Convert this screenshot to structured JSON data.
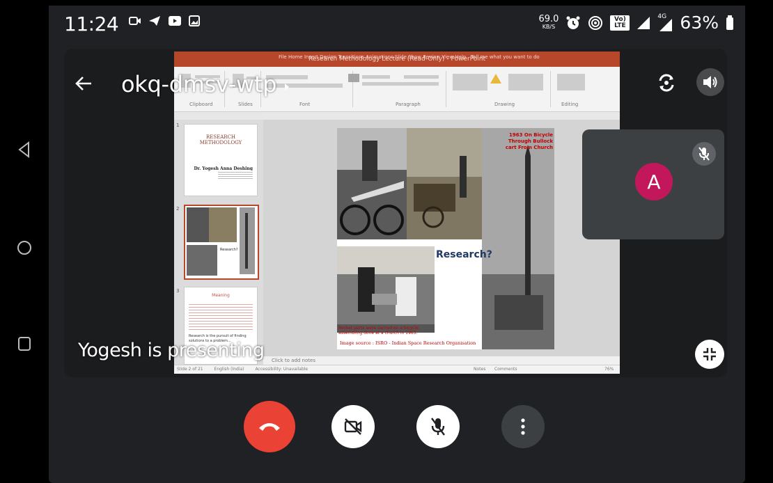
{
  "status_bar": {
    "time": "11:24",
    "net_speed_value": "69.0",
    "net_speed_unit": "KB/S",
    "volte": "Vo) LTE",
    "network": "4G",
    "battery": "63%"
  },
  "meeting": {
    "code": "okq-dmsv-wtp",
    "presenting_text": "Yogesh is presenting"
  },
  "participant": {
    "initial": "A",
    "avatar_color": "#c2185b"
  },
  "colors": {
    "end_call": "#ea4335",
    "tile_bg": "#3c4043",
    "ppt_accent": "#b7472a"
  },
  "presentation": {
    "window_title": "Research Methodology Lecture (Read-Only) - PowerPoint",
    "ribbon_tabs": "File  Home  Insert  Design  Transitions  Animations  Slide Show  Review  View  Help",
    "tell_me": "Tell me what you want to do",
    "ribbon_groups": [
      "Clipboard",
      "Slides",
      "Font",
      "Paragraph",
      "Drawing",
      "Editing"
    ],
    "thumb1_title": "RESEARCH METHODOLOGY",
    "thumb1_author": "Dr. Yogesh Anna Deshing",
    "thumb3_heading": "Meaning",
    "thumb3_text": "Research is the pursuit of finding solutions to a problem...",
    "slide_overlay_title": "1963 On Bicycle Through Bullock cart From Church",
    "slide_research_text": "Research?",
    "slide_caption": "Rocket parts were carried on a bicycle; assembling done at a church in 1963.",
    "slide_source": "Image source : ISRO - Indian Space Research Organisation",
    "notes_placeholder": "Click to add notes",
    "status_slide": "Slide 2 of 21",
    "status_lang": "English (India)",
    "status_access": "Accessibility: Unavailable",
    "status_notes": "Notes",
    "status_comments": "Comments",
    "zoom": "76%"
  },
  "icons": {
    "back": "arrow-left-icon",
    "camera_flip": "camera-switch-icon",
    "speaker": "speaker-icon",
    "minimize": "minimize-icon",
    "end_call": "call-end-icon",
    "camera_off": "videocam-off-icon",
    "mic_off": "mic-off-icon",
    "more": "more-vert-icon"
  }
}
